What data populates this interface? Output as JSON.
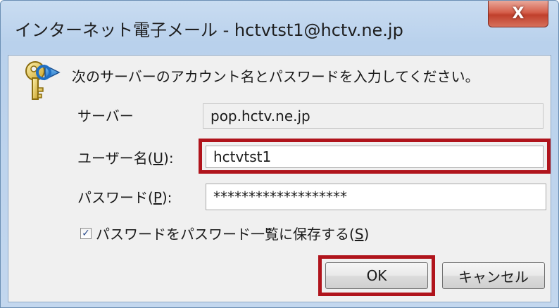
{
  "window": {
    "title": "インターネット電子メール - hctvtst1@hctv.ne.jp",
    "close_glyph": "X"
  },
  "prompt": "次のサーバーのアカウント名とパスワードを入力してください。",
  "server": {
    "label": "サーバー",
    "value": "pop.hctv.ne.jp"
  },
  "username": {
    "label_prefix": "ユーザー名(",
    "label_accel": "U",
    "label_suffix": "):",
    "value": "hctvtst1"
  },
  "password": {
    "label_prefix": "パスワード(",
    "label_accel": "P",
    "label_suffix": "):",
    "value": "*******************"
  },
  "save_password": {
    "checked": true,
    "check_glyph": "✓",
    "label_prefix": "パスワードをパスワード一覧に保存する(",
    "label_accel": "S",
    "label_suffix": ")"
  },
  "buttons": {
    "ok": "OK",
    "cancel": "キャンセル"
  },
  "colors": {
    "highlight": "#b0141c",
    "titlebar": "#b9d1ec",
    "close": "#c0402c"
  },
  "icons": {
    "key": "key-icon"
  }
}
